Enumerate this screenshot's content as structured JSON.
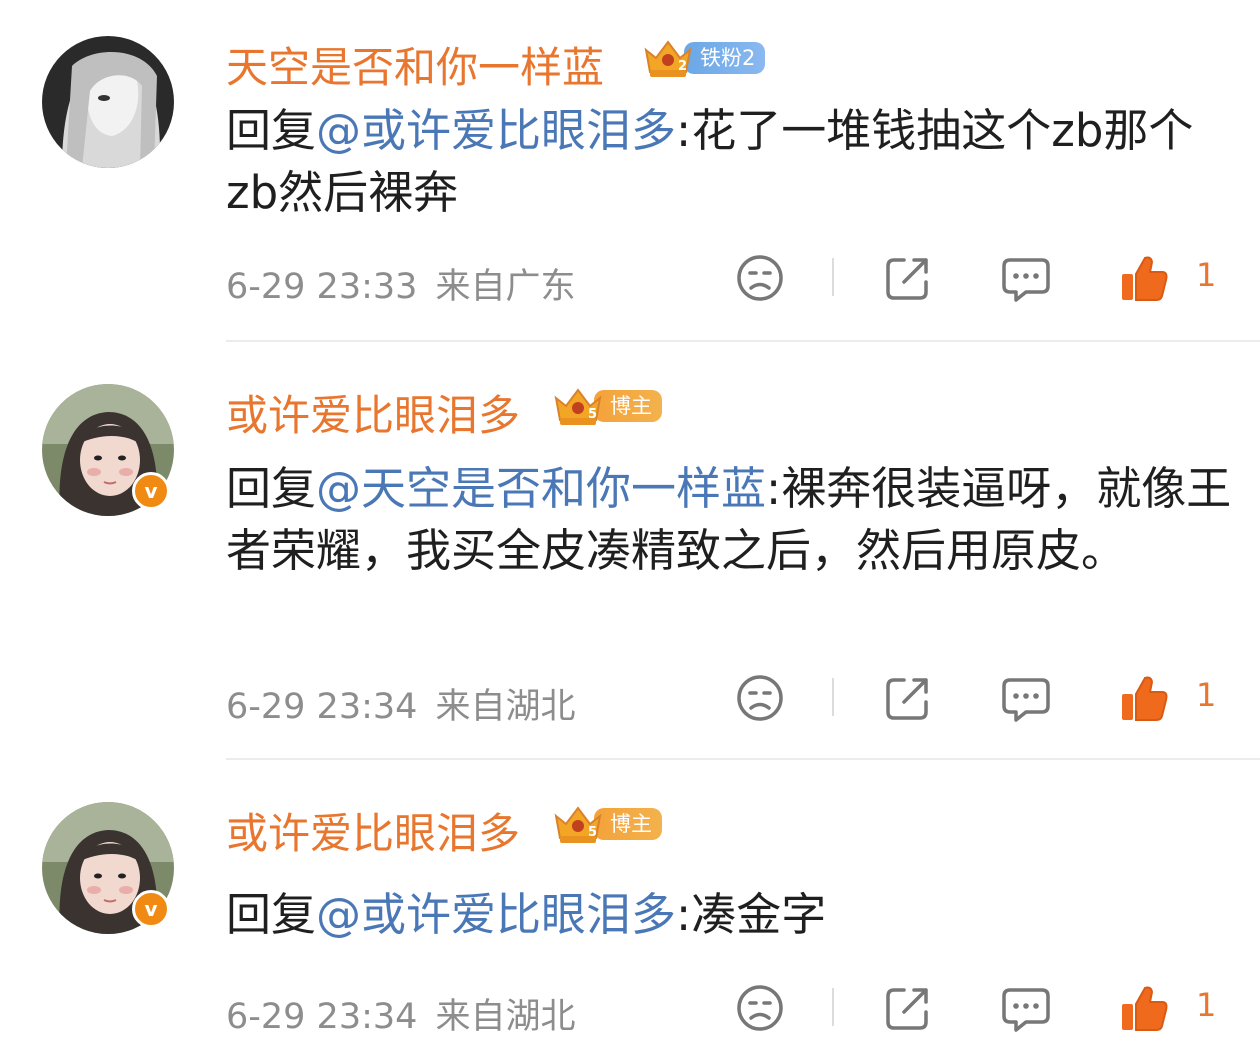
{
  "comments": [
    {
      "username": "天空是否和你一样蓝",
      "badge_label": "铁粉2",
      "text_prefix": "回复",
      "mention": "@或许爱比眼泪多",
      "text_body": ":花了一堆钱抽这个zb那个zb然后裸奔",
      "time": "6-29 23:33",
      "location": "来自广东",
      "likes": "1"
    },
    {
      "username": "或许爱比眼泪多",
      "badge_label": "博主",
      "text_prefix": "回复",
      "mention": "@天空是否和你一样蓝",
      "text_body": ":裸奔很装逼呀，就像王者荣耀，我买全皮凑精致之后，然后用原皮。",
      "time": "6-29 23:34",
      "location": "来自湖北",
      "likes": "1"
    },
    {
      "username": "或许爱比眼泪多",
      "badge_label": "博主",
      "text_prefix": "回复",
      "mention": "@或许爱比眼泪多",
      "text_body": ":凑金字",
      "time": "6-29 23:34",
      "location": "来自湖北",
      "likes": "1"
    }
  ],
  "icons": {
    "dislike": "sad-face-icon",
    "share": "share-icon",
    "reply": "comment-bubble-icon",
    "like": "thumbs-up-icon"
  },
  "colors": {
    "username": "#e8762e",
    "mention": "#4a78b6",
    "meta": "#8d8d8d",
    "like": "#f06a1d",
    "verified": "#f08a13"
  }
}
